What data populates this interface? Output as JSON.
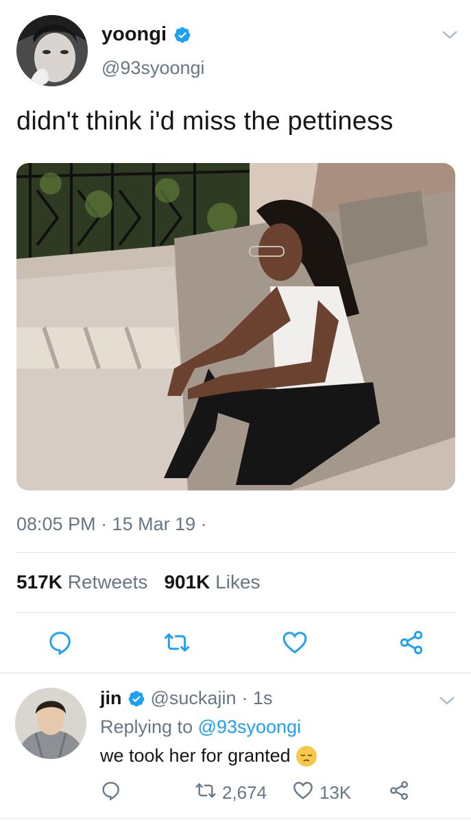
{
  "tweet": {
    "display_name": "yoongi",
    "handle": "@93syoongi",
    "text": "didn't think i'd miss the pettiness",
    "timestamp": "08:05 PM · 15 Mar 19 ·",
    "retweets_count": "517K",
    "retweets_label": "Retweets",
    "likes_count": "901K",
    "likes_label": "Likes"
  },
  "reply": {
    "display_name": "jin",
    "handle": "@suckajin",
    "time": "· 1s",
    "replying_prefix": "Replying to",
    "replying_to": "@93syoongi",
    "text": "we took her for granted",
    "retweets": "2,674",
    "likes": "13K"
  },
  "icons": {
    "verified": "verified-badge-icon",
    "chevron": "chevron-down-icon",
    "reply": "reply-icon",
    "retweet": "retweet-icon",
    "like": "heart-icon",
    "share": "share-icon",
    "emoji": "pensive-face-emoji"
  },
  "colors": {
    "accent": "#1da1f2",
    "secondary_text": "#657786",
    "primary_text": "#14171a",
    "divider": "#dfe3e6"
  }
}
